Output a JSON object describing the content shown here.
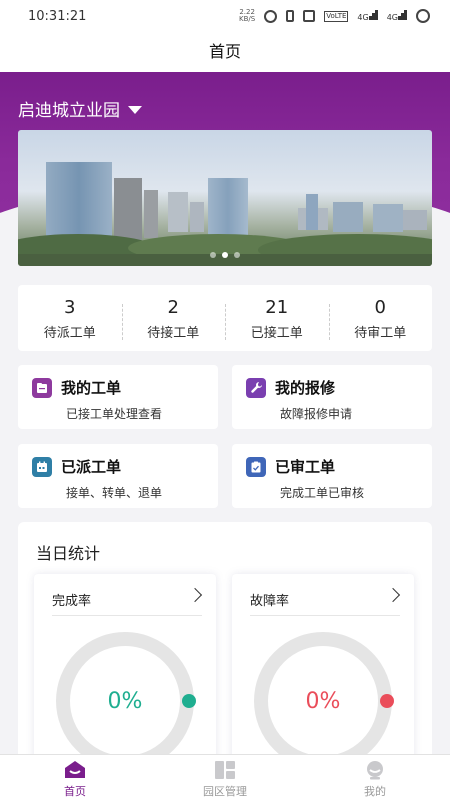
{
  "status_bar": {
    "time": "10:31:21",
    "net_speed_value": "2.22",
    "net_speed_unit": "KB/S",
    "volte": "VoLTE",
    "signal1": "4G",
    "signal2": "4G"
  },
  "header": {
    "title": "首页"
  },
  "park": {
    "name": "启迪城立业园"
  },
  "banner": {
    "slides": 3,
    "active": 1
  },
  "stats": [
    {
      "value": "3",
      "label": "待派工单"
    },
    {
      "value": "2",
      "label": "待接工单"
    },
    {
      "value": "21",
      "label": "已接工单"
    },
    {
      "value": "0",
      "label": "待审工单"
    }
  ],
  "functions": [
    {
      "title": "我的工单",
      "subtitle": "已接工单处理查看",
      "icon": "document-icon",
      "color": "#8e3a9e"
    },
    {
      "title": "我的报修",
      "subtitle": "故障报修申请",
      "icon": "wrench-icon",
      "color": "#7a3fb0"
    },
    {
      "title": "已派工单",
      "subtitle": "接单、转单、退单",
      "icon": "calendar-icon",
      "color": "#2f7fa6"
    },
    {
      "title": "已审工单",
      "subtitle": "完成工单已审核",
      "icon": "clipboard-check-icon",
      "color": "#3f66b8"
    }
  ],
  "daily": {
    "title": "当日统计",
    "cards": [
      {
        "label": "完成率",
        "value": "0%",
        "percent": 0,
        "color": "#1fae90"
      },
      {
        "label": "故障率",
        "value": "0%",
        "percent": 0,
        "color": "#ea4d5a"
      }
    ]
  },
  "tabs": [
    {
      "label": "首页",
      "icon": "home-icon",
      "active": true
    },
    {
      "label": "园区管理",
      "icon": "grid-icon",
      "active": false
    },
    {
      "label": "我的",
      "icon": "user-face-icon",
      "active": false
    }
  ],
  "colors": {
    "brand": "#7a1e8c",
    "success": "#1fae90",
    "danger": "#ea4d5a"
  }
}
